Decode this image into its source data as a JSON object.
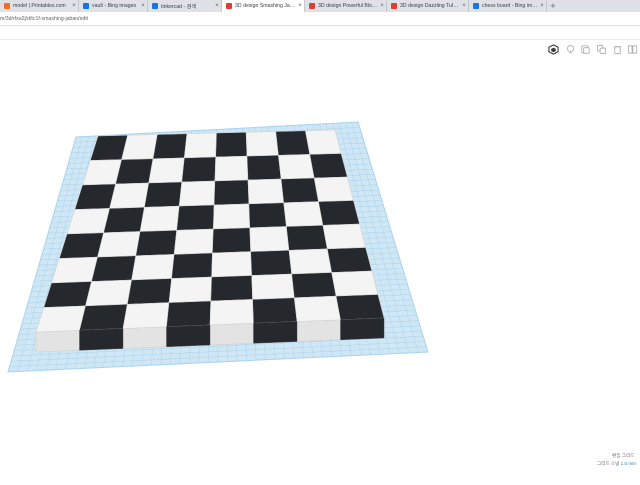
{
  "browser": {
    "tabs": [
      {
        "title": "model | Printables.com",
        "icon": "printables-icon",
        "color": "#f26d21",
        "active": false
      },
      {
        "title": "vault - Bing images",
        "icon": "bing-search-icon",
        "color": "#1a73e8",
        "active": false
      },
      {
        "title": "tinkercad - 검색",
        "icon": "search-icon",
        "color": "#1a73e8",
        "active": false
      },
      {
        "title": "3D design Smashing Jaban | Tin",
        "icon": "tinkercad-icon",
        "color": "#e03c31",
        "active": true
      },
      {
        "title": "3D design Powerful Blorr | Tinke",
        "icon": "tinkercad-icon",
        "color": "#e03c31",
        "active": false
      },
      {
        "title": "3D design Dazzling Tularis-Mu",
        "icon": "tinkercad-icon",
        "color": "#e03c31",
        "active": false
      },
      {
        "title": "chess board - Bing images",
        "icon": "bing-search-icon",
        "color": "#1a73e8",
        "active": false
      }
    ],
    "new_tab_label": "+",
    "url": "m/3d/rfxa2j/d/tc1f-smashing-jaban/edit"
  },
  "toolbar": {
    "icons": [
      "view-cube-icon",
      "lightbulb-icon",
      "note-icon",
      "duplicate-icon",
      "delete-icon",
      "group-icon"
    ]
  },
  "workplane": {
    "grid_label": "편집 그리드",
    "snap_label": "그리드 스냅",
    "snap_value": "1.0 mm",
    "colors": {
      "plane": "#cfe6f5",
      "grid_line": "#8fc4e6",
      "dark_square": "#25282c",
      "light_square": "#f4f4f4",
      "side": "#e3e3e3"
    },
    "board": {
      "rows": 8,
      "cols": 8,
      "dark_first": true
    }
  }
}
